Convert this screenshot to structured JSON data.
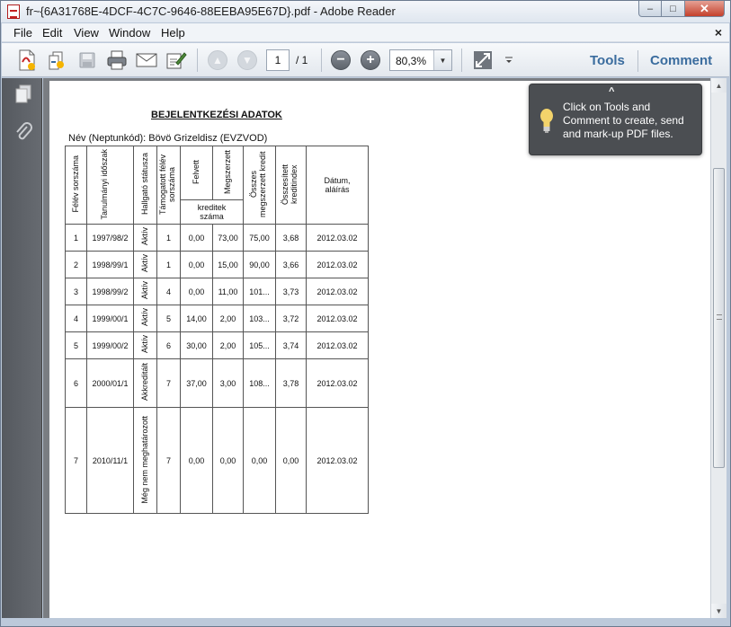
{
  "window": {
    "title": "fr~{6A31768E-4DCF-4C7C-9646-88EEBA95E67D}.pdf - Adobe Reader",
    "minimize": "–",
    "maximize": "□",
    "close": "✕"
  },
  "menu": {
    "file": "File",
    "edit": "Edit",
    "view": "View",
    "window": "Window",
    "help": "Help",
    "doc_close": "×"
  },
  "toolbar": {
    "page_current": "1",
    "page_total": "/ 1",
    "zoom": "80,3%",
    "tools": "Tools",
    "comment": "Comment",
    "icons": [
      "create-pdf-icon",
      "combine-icon",
      "save-icon",
      "print-icon",
      "email-icon",
      "sign-icon",
      "prev-page-icon",
      "next-page-icon",
      "zoom-out-icon",
      "zoom-in-icon",
      "fit-icon",
      "options-icon"
    ]
  },
  "tooltip": {
    "text": "Click on Tools and Comment to create, send and mark-up PDF files."
  },
  "document": {
    "title": "BEJELENTKEZÉSI ADATOK",
    "name_label": "Név (Neptunkód):",
    "name_value": "Bövö Grizeldisz (EVZVOD)",
    "headers": {
      "semester_no": "Félév sorszáma",
      "academic_period": "Tanulmányi időszak",
      "student_status": "Hallgató státusza",
      "funded_semester_no": "Támogatott félév sorszáma",
      "registered": "Felvett",
      "earned": "Megszerzett",
      "credits_count": "kreditek száma",
      "total_earned_credit": "Összes megszerzett kredit",
      "aggregate_credit_index": "Összesített kreditindex",
      "date_signature": "Dátum, aláírás"
    },
    "rows": [
      {
        "no": "1",
        "period": "1997/98/2",
        "status": "Aktív",
        "funded": "1",
        "registered": "0,00",
        "earned": "73,00",
        "total": "75,00",
        "index": "3,68",
        "date": "2012.03.02"
      },
      {
        "no": "2",
        "period": "1998/99/1",
        "status": "Aktív",
        "funded": "1",
        "registered": "0,00",
        "earned": "15,00",
        "total": "90,00",
        "index": "3,66",
        "date": "2012.03.02"
      },
      {
        "no": "3",
        "period": "1998/99/2",
        "status": "Aktív",
        "funded": "4",
        "registered": "0,00",
        "earned": "11,00",
        "total": "101...",
        "index": "3,73",
        "date": "2012.03.02"
      },
      {
        "no": "4",
        "period": "1999/00/1",
        "status": "Aktív",
        "funded": "5",
        "registered": "14,00",
        "earned": "2,00",
        "total": "103...",
        "index": "3,72",
        "date": "2012.03.02"
      },
      {
        "no": "5",
        "period": "1999/00/2",
        "status": "Aktív",
        "funded": "6",
        "registered": "30,00",
        "earned": "2,00",
        "total": "105...",
        "index": "3,74",
        "date": "2012.03.02"
      },
      {
        "no": "6",
        "period": "2000/01/1",
        "status": "Akkreditált",
        "funded": "7",
        "registered": "37,00",
        "earned": "3,00",
        "total": "108...",
        "index": "3,78",
        "date": "2012.03.02"
      },
      {
        "no": "7",
        "period": "2010/11/1",
        "status": "Még nem meghatározott",
        "funded": "7",
        "registered": "0,00",
        "earned": "0,00",
        "total": "0,00",
        "index": "0,00",
        "date": "2012.03.02"
      }
    ]
  },
  "colors": {
    "accent_link": "#3a6c9e",
    "left_panel": "#5e6268",
    "doc_background": "#7a7d82",
    "tooltip_bg": "#4b4e52"
  }
}
